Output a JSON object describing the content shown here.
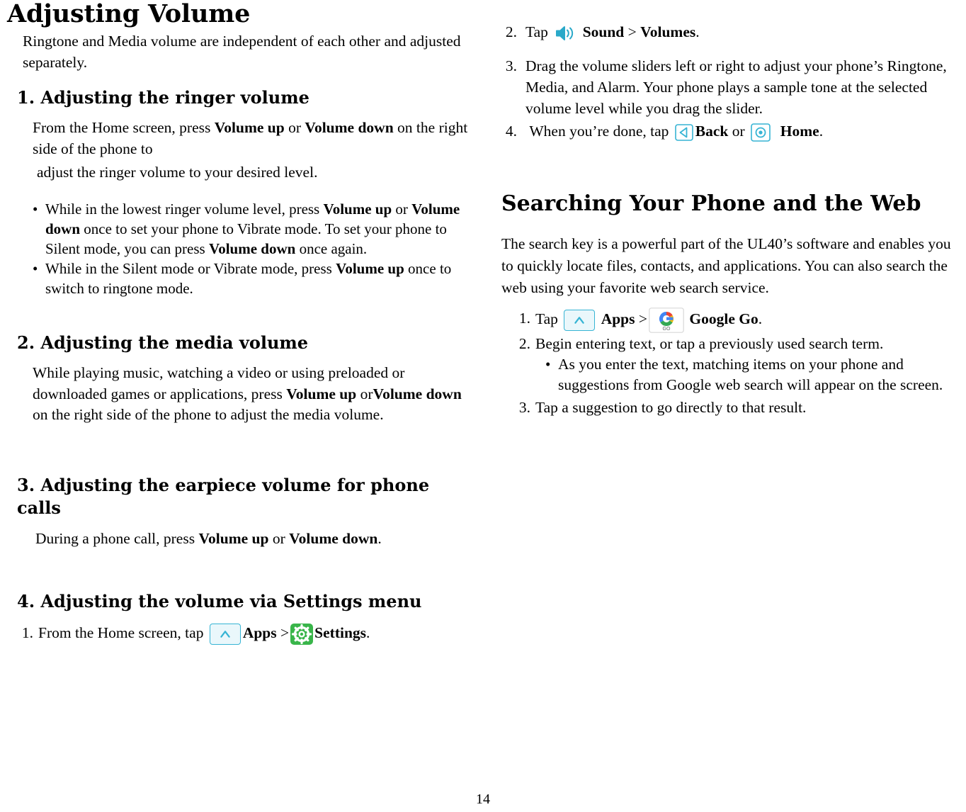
{
  "document": {
    "title": "Adjusting Volume",
    "page_number": "14"
  },
  "left_column": {
    "intro": "Ringtone and Media volume are independent of each other and adjusted separately.",
    "section1": {
      "heading": "1. Adjusting the ringer volume",
      "body_1": "From the Home screen, press ",
      "body_bold_1": "Volume up",
      "body_2": " or ",
      "body_bold_2": "Volume down",
      "body_3": " on the right side of the phone to",
      "body_4": "adjust the ringer volume to your desired level.",
      "bullets": [
        {
          "part1": "While in the lowest ringer volume level, press ",
          "bold1": "Volume up",
          "part2": " or ",
          "bold2": "Volume down",
          "part3": " once to set your phone to Vibrate mode. To set your phone to Silent mode, you can press ",
          "bold3": "Volume down",
          "part4": " once again."
        },
        {
          "part1": "While in the Silent mode or Vibrate mode, press ",
          "bold1": "Volume up",
          "part2": " once to switch to ringtone mode."
        }
      ]
    },
    "section2": {
      "heading": "2. Adjusting the media volume",
      "body_1": "While playing music, watching a video or using preloaded or downloaded games or applications, press ",
      "body_bold_1": "Volume up",
      "body_2": " or",
      "body_bold_2": "Volume down",
      "body_3": " on the right side of the phone to adjust the media volume."
    },
    "section3": {
      "heading": "3. Adjusting the earpiece volume for phone calls",
      "body_1": "During a phone call, press ",
      "body_bold_1": "Volume up",
      "body_2": " or ",
      "body_bold_2": "Volume down",
      "body_3": "."
    },
    "section4": {
      "heading": "4. Adjusting the volume via Settings menu",
      "step1": {
        "number": "1.",
        "text_1": "From the Home screen, tap ",
        "apps_label": "Apps",
        "sep": " >",
        "settings_label": "Settings",
        "period": "."
      }
    }
  },
  "right_column": {
    "steps": [
      {
        "number": "2.",
        "text_1": "Tap ",
        "bold_1": "Sound",
        "text_2": " > ",
        "bold_2": "Volumes",
        "text_3": "."
      },
      {
        "number": "3.",
        "text_1": "Drag the volume sliders left or right to adjust your phone’s Ringtone, Media, and Alarm. Your phone plays a sample tone at the selected volume level while you drag the slider."
      },
      {
        "number": "4.",
        "text_1": "When you’re done, tap ",
        "bold_1": "Back",
        "text_2": " or ",
        "bold_2": "Home",
        "text_3": "."
      }
    ],
    "section_heading": "Searching Your Phone and the Web",
    "section_body": "The search key is a powerful part of the UL40’s software and enables you to quickly locate files, contacts, and applications. You can also search the web using your favorite web search service.",
    "search_steps": {
      "step1": {
        "number": "1.",
        "text_1": "Tap ",
        "apps_label": "Apps",
        "sep": " >",
        "google_label": "Google Go",
        "period": "."
      },
      "step2": {
        "number": "2.",
        "text_1": "Begin entering text, or tap a previously used search term."
      },
      "step2_bullet": "As you enter the text, matching items on your phone and suggestions from Google web search will appear on the screen.",
      "step3": {
        "number": "3.",
        "text_1": "Tap a suggestion to go directly to that result."
      }
    }
  },
  "icons": {
    "sound": "sound-icon",
    "back": "back-icon",
    "home": "home-icon",
    "apps": "apps-icon",
    "settings": "settings-icon",
    "google_go": "google-go-icon"
  },
  "colors": {
    "icon_blue": "#36b4d4",
    "settings_green": "#39b54a",
    "google_blue": "#4285f4",
    "google_red": "#ea4335",
    "google_yellow": "#fbbc05",
    "google_green": "#34a853"
  }
}
